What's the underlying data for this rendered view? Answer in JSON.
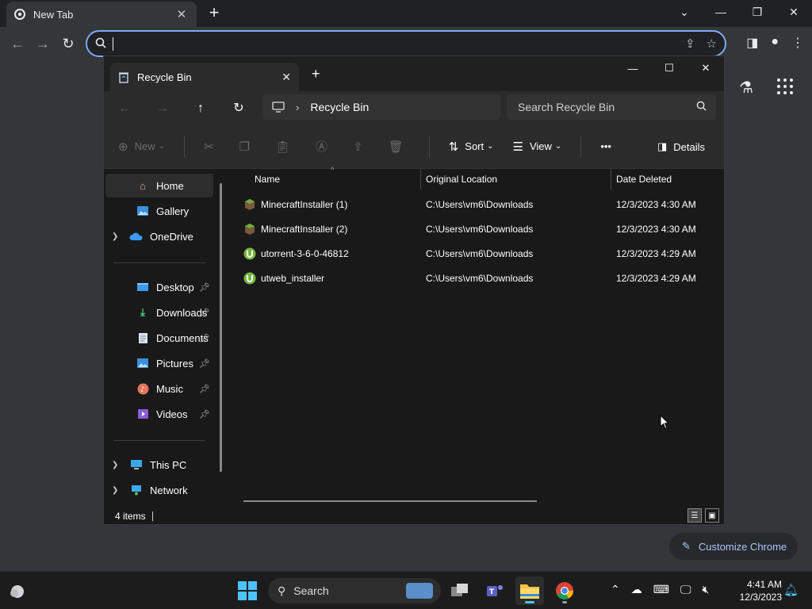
{
  "chrome": {
    "tab_title": "New Tab",
    "omnibox_value": "",
    "customize_label": "Customize Chrome"
  },
  "explorer": {
    "tab_title": "Recycle Bin",
    "breadcrumb": [
      "Recycle Bin"
    ],
    "search_placeholder": "Search Recycle Bin",
    "commands": {
      "new": "New",
      "sort": "Sort",
      "view": "View",
      "more": "•••",
      "details": "Details"
    },
    "sidebar": {
      "home": "Home",
      "gallery": "Gallery",
      "onedrive": "OneDrive",
      "quick_access": [
        {
          "label": "Desktop",
          "icon": "desktop-icon"
        },
        {
          "label": "Downloads",
          "icon": "downloads-icon"
        },
        {
          "label": "Documents",
          "icon": "documents-icon"
        },
        {
          "label": "Pictures",
          "icon": "pictures-icon"
        },
        {
          "label": "Music",
          "icon": "music-icon"
        },
        {
          "label": "Videos",
          "icon": "videos-icon"
        }
      ],
      "this_pc": "This PC",
      "network": "Network"
    },
    "columns": {
      "name": "Name",
      "original_location": "Original Location",
      "date_deleted": "Date Deleted"
    },
    "files": [
      {
        "name": "MinecraftInstaller (1)",
        "location": "C:\\Users\\vm6\\Downloads",
        "date": "12/3/2023 4:30 AM",
        "icon": "minecraft-installer-icon"
      },
      {
        "name": "MinecraftInstaller (2)",
        "location": "C:\\Users\\vm6\\Downloads",
        "date": "12/3/2023 4:30 AM",
        "icon": "minecraft-installer-icon"
      },
      {
        "name": "utorrent-3-6-0-46812",
        "location": "C:\\Users\\vm6\\Downloads",
        "date": "12/3/2023 4:29 AM",
        "icon": "utorrent-icon"
      },
      {
        "name": "utweb_installer",
        "location": "C:\\Users\\vm6\\Downloads",
        "date": "12/3/2023 4:29 AM",
        "icon": "utorrent-icon"
      }
    ],
    "status_count": "4 items"
  },
  "taskbar": {
    "search_label": "Search",
    "time": "4:41 AM",
    "date": "12/3/2023"
  },
  "colors": {
    "accent": "#4cc2ff",
    "chrome_focus": "#7cacf8"
  }
}
